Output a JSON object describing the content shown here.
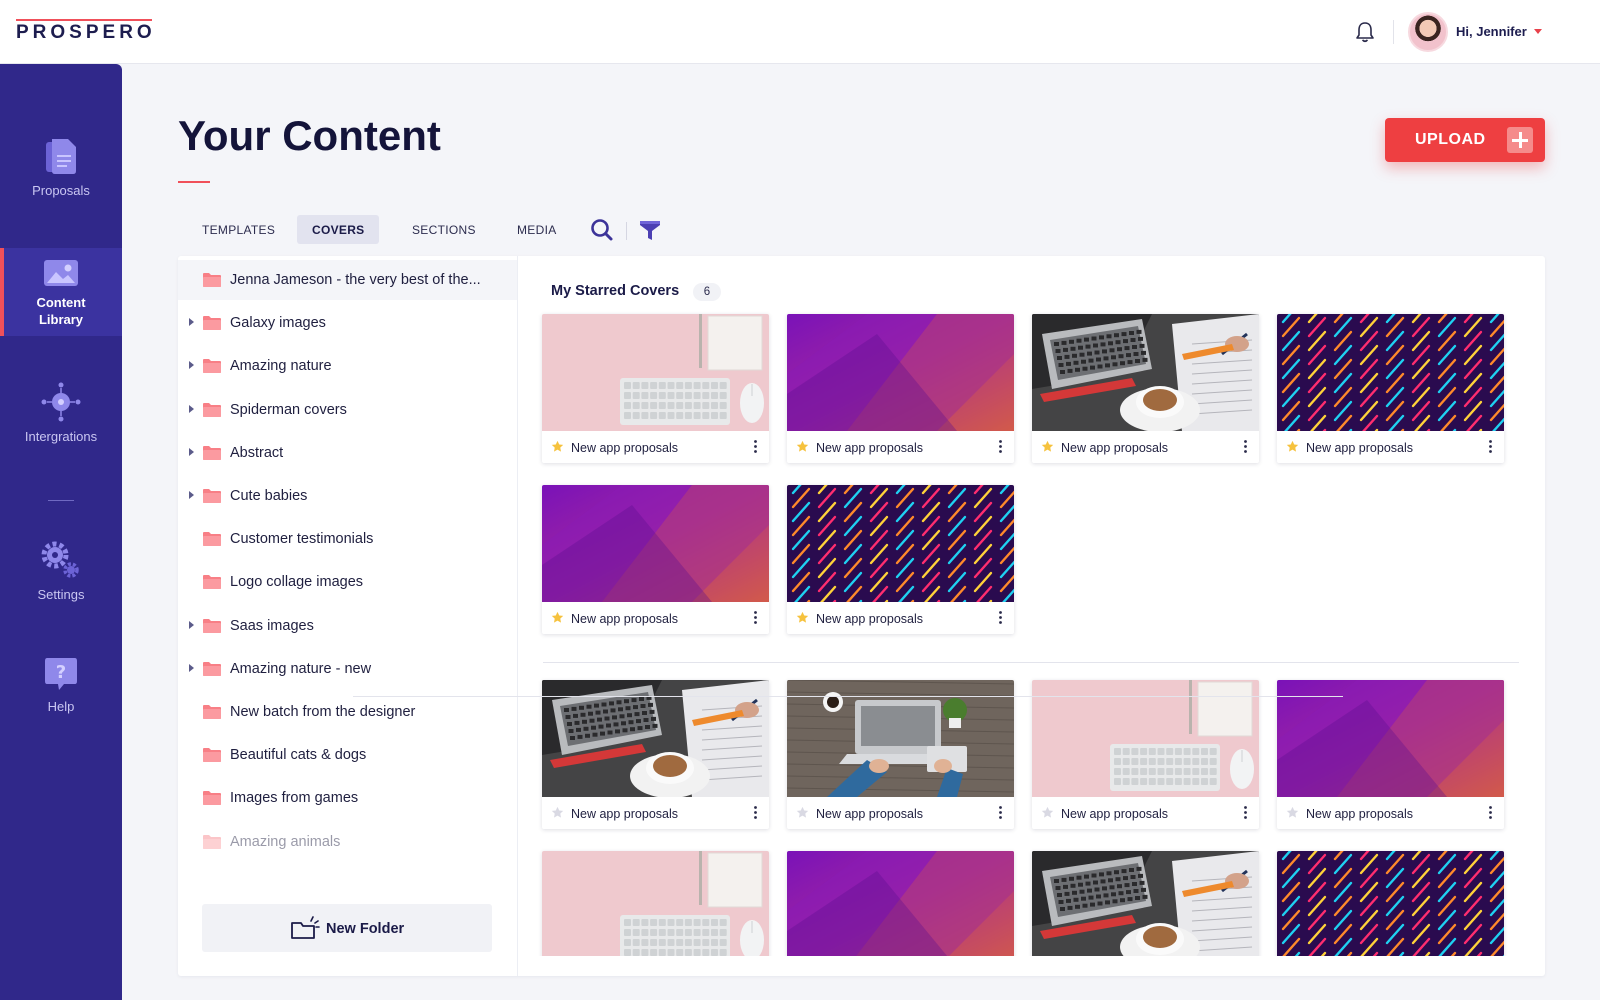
{
  "app": {
    "logo": "PROSPERO"
  },
  "header": {
    "greeting": "Hi, Jennifer"
  },
  "sidebar": {
    "items": [
      {
        "label": "Proposals",
        "icon": "document-icon"
      },
      {
        "label": "Content Library",
        "icon": "image-icon",
        "active": true
      },
      {
        "label": "Intergrations",
        "icon": "integrations-icon"
      },
      {
        "label": "Settings",
        "icon": "gears-icon"
      },
      {
        "label": "Help",
        "icon": "help-icon"
      }
    ]
  },
  "page": {
    "title": "Your Content",
    "upload_label": "UPLOAD"
  },
  "tabs": [
    {
      "label": "TEMPLATES"
    },
    {
      "label": "COVERS",
      "active": true
    },
    {
      "label": "SECTIONS"
    },
    {
      "label": "MEDIA"
    }
  ],
  "folders": [
    {
      "name": "Jenna Jameson - the very best of the...",
      "expandable": false,
      "selected": true
    },
    {
      "name": "Galaxy images",
      "expandable": true
    },
    {
      "name": "Amazing nature",
      "expandable": true
    },
    {
      "name": "Spiderman covers",
      "expandable": true
    },
    {
      "name": "Abstract",
      "expandable": true
    },
    {
      "name": "Cute babies",
      "expandable": true
    },
    {
      "name": "Customer testimonials",
      "expandable": false
    },
    {
      "name": "Logo collage images",
      "expandable": false
    },
    {
      "name": "Saas images",
      "expandable": true
    },
    {
      "name": "Amazing nature - new",
      "expandable": true
    },
    {
      "name": "New batch from the designer",
      "expandable": false
    },
    {
      "name": "Beautiful cats & dogs",
      "expandable": false
    },
    {
      "name": "Images from games",
      "expandable": false
    },
    {
      "name": "Amazing animals",
      "expandable": false
    }
  ],
  "new_folder_label": "New Folder",
  "starred": {
    "title": "My Starred Covers",
    "count": "6",
    "cards": [
      {
        "name": "New app proposals",
        "thumb": "pink",
        "starred": true
      },
      {
        "name": "New app proposals",
        "thumb": "purple",
        "starred": true
      },
      {
        "name": "New app proposals",
        "thumb": "photo",
        "starred": true
      },
      {
        "name": "New app proposals",
        "thumb": "lines",
        "starred": true
      },
      {
        "name": "New app proposals",
        "thumb": "purple",
        "starred": true
      },
      {
        "name": "New app proposals",
        "thumb": "lines",
        "starred": true
      }
    ]
  },
  "all_covers": {
    "cards": [
      {
        "name": "New app proposals",
        "thumb": "photo",
        "starred": false
      },
      {
        "name": "New app proposals",
        "thumb": "desk",
        "starred": false
      },
      {
        "name": "New app proposals",
        "thumb": "pink",
        "starred": false
      },
      {
        "name": "New app proposals",
        "thumb": "purple",
        "starred": false
      },
      {
        "name": "",
        "thumb": "pink",
        "starred": false
      },
      {
        "name": "",
        "thumb": "purple",
        "starred": false
      },
      {
        "name": "",
        "thumb": "photo",
        "starred": false
      },
      {
        "name": "",
        "thumb": "lines",
        "starred": false
      }
    ]
  },
  "colors": {
    "sidebar": "#30288a",
    "accent": "#ee3f41",
    "folder": "#f87f86",
    "star_on": "#f6c23e",
    "star_off": "#d9d9e3"
  }
}
